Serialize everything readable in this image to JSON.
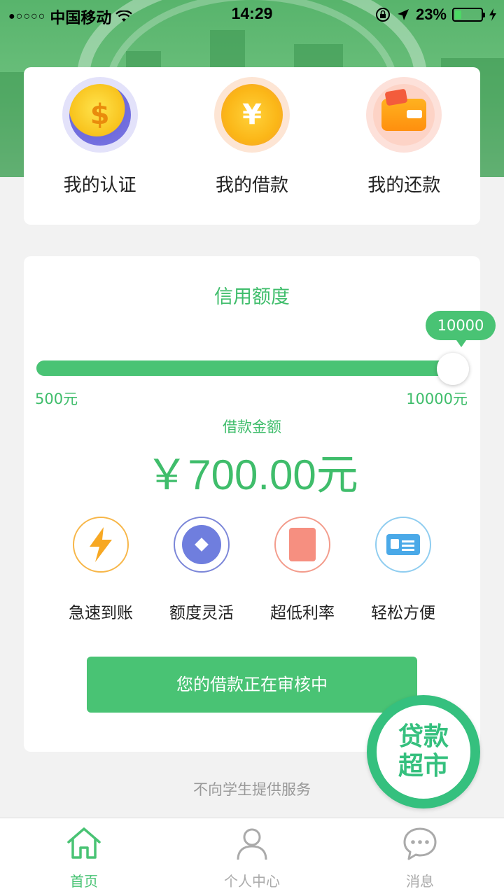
{
  "status_bar": {
    "carrier": "中国移动",
    "time": "14:29",
    "battery": "23%"
  },
  "top_menu": {
    "items": [
      {
        "label": "我的认证",
        "icon": "lightbulb-dollar-icon"
      },
      {
        "label": "我的借款",
        "icon": "yen-coin-icon"
      },
      {
        "label": "我的还款",
        "icon": "wallet-icon"
      }
    ],
    "coin_symbols": {
      "dollar": "$",
      "yen": "¥"
    }
  },
  "credit": {
    "title": "信用额度",
    "slider_value": "10000",
    "slider_fraction": 1.0,
    "min_label": "500元",
    "max_label": "10000元",
    "amount_label": "借款金额",
    "amount": "￥700.00元"
  },
  "features": [
    {
      "label": "急速到账",
      "icon": "lightning-icon"
    },
    {
      "label": "额度灵活",
      "icon": "diamond-icon"
    },
    {
      "label": "超低利率",
      "icon": "rate-card-icon"
    },
    {
      "label": "轻松方便",
      "icon": "id-card-icon"
    }
  ],
  "submit_button": "您的借款正在审核中",
  "market_button": "贷款超市",
  "notice": "不向学生提供服务",
  "tabbar": {
    "items": [
      {
        "label": "首页",
        "icon": "home-icon",
        "active": true
      },
      {
        "label": "个人中心",
        "icon": "person-icon",
        "active": false
      },
      {
        "label": "消息",
        "icon": "message-icon",
        "active": false
      }
    ]
  },
  "colors": {
    "accent": "#49c374",
    "text": "#222222",
    "muted": "#aaaaaa"
  }
}
